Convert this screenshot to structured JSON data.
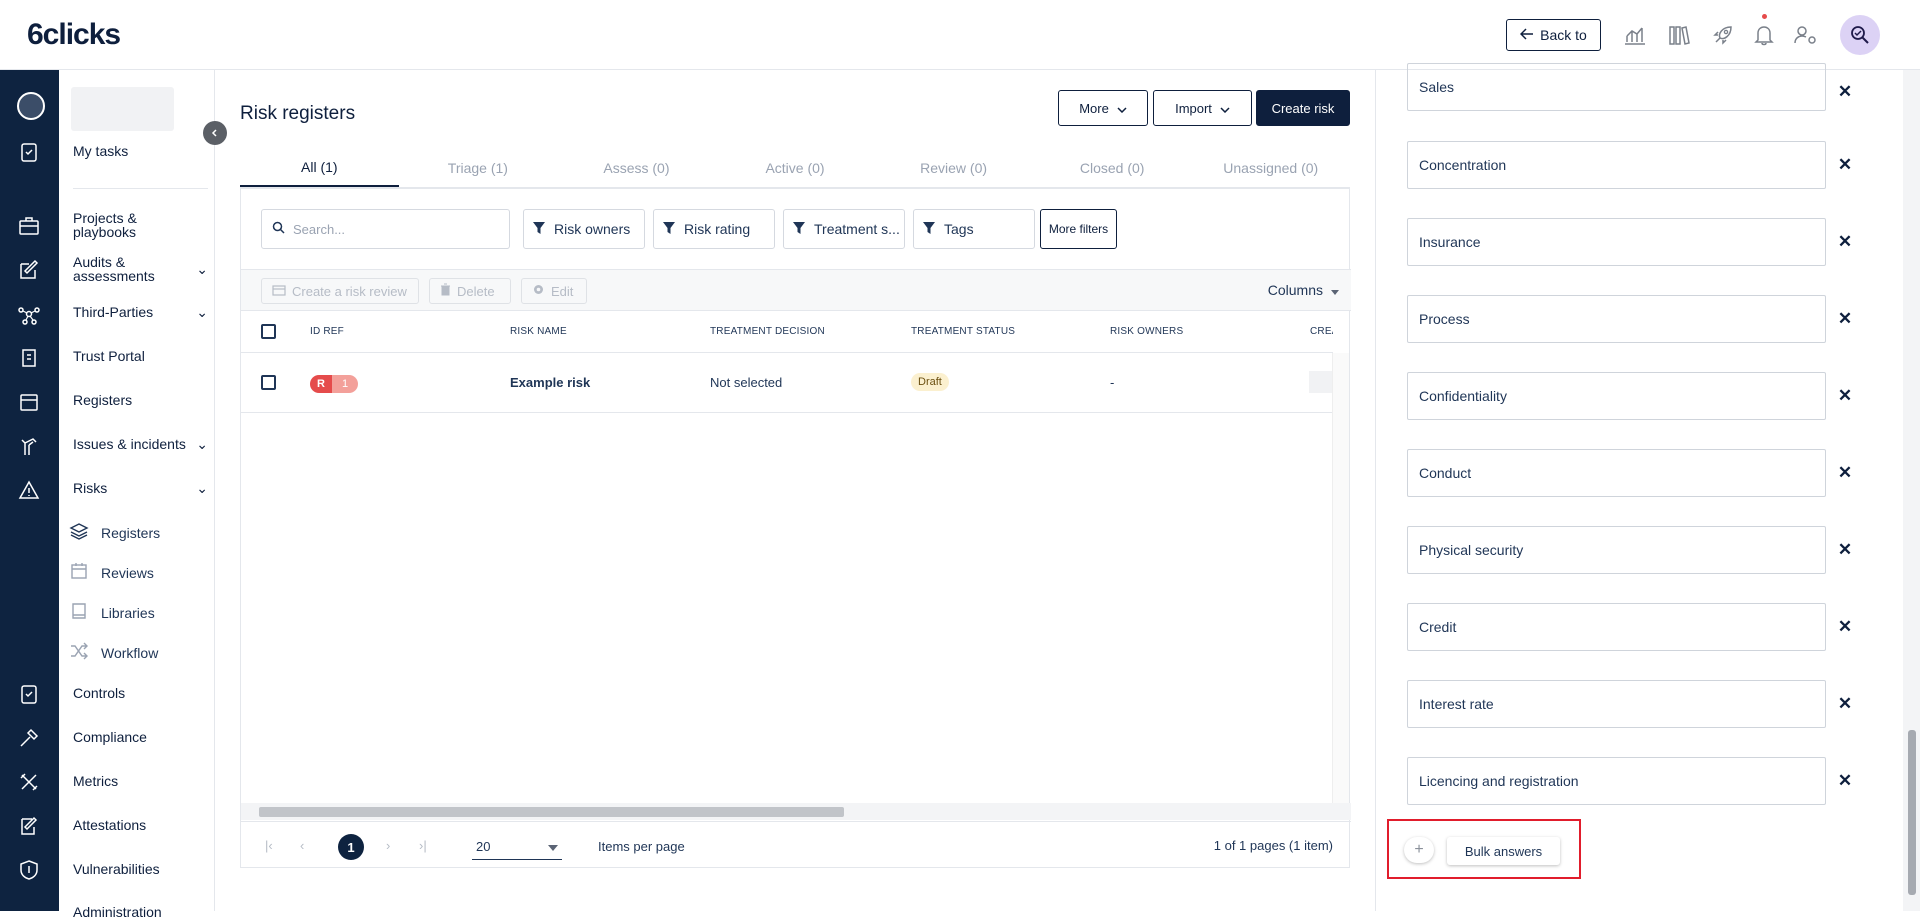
{
  "app": {
    "logo": "6clicks"
  },
  "topbar": {
    "back_label": "Back to"
  },
  "nav": {
    "my_tasks": "My tasks",
    "projects": "Projects & playbooks",
    "audits": "Audits & assessments",
    "third_parties": "Third-Parties",
    "trust_portal": "Trust Portal",
    "registers": "Registers",
    "issues": "Issues & incidents",
    "risks": "Risks",
    "risks_sub": [
      "Registers",
      "Reviews",
      "Libraries",
      "Workflow"
    ],
    "controls": "Controls",
    "compliance": "Compliance",
    "metrics": "Metrics",
    "attestations": "Attestations",
    "vulnerabilities": "Vulnerabilities",
    "administration": "Administration"
  },
  "page": {
    "title": "Risk registers",
    "more_label": "More",
    "import_label": "Import",
    "create_label": "Create risk"
  },
  "tabs": [
    "All (1)",
    "Triage (1)",
    "Assess (0)",
    "Active (0)",
    "Review (0)",
    "Closed (0)",
    "Unassigned (0)"
  ],
  "filters": {
    "search_placeholder": "Search...",
    "risk_owners": "Risk owners",
    "risk_rating": "Risk rating",
    "treatment": "Treatment s...",
    "tags": "Tags",
    "more_filters": "More filters"
  },
  "toolbar": {
    "create_review": "Create a risk review",
    "delete": "Delete",
    "edit": "Edit",
    "columns": "Columns"
  },
  "table": {
    "headers": [
      "ID REF",
      "RISK NAME",
      "TREATMENT DECISION",
      "TREATMENT STATUS",
      "RISK OWNERS",
      "CREATED"
    ],
    "rows": [
      {
        "id_prefix": "R",
        "id_num": "1",
        "name": "Example risk",
        "decision": "Not selected",
        "status": "Draft",
        "owners": "-"
      }
    ]
  },
  "pager": {
    "current": "1",
    "per_page": "20",
    "per_page_label": "Items per page",
    "info": "1 of 1 pages (1 item)"
  },
  "answers": [
    "Sales",
    "Concentration",
    "Insurance",
    "Process",
    "Confidentiality",
    "Conduct",
    "Physical security",
    "Credit",
    "Interest rate",
    "Licencing and registration"
  ],
  "bulk": {
    "label": "Bulk answers"
  },
  "colors": {
    "primary": "#0e1f3d",
    "rail": "#0e2340",
    "danger": "#e54b4b",
    "highlight": "#e11d2c"
  }
}
